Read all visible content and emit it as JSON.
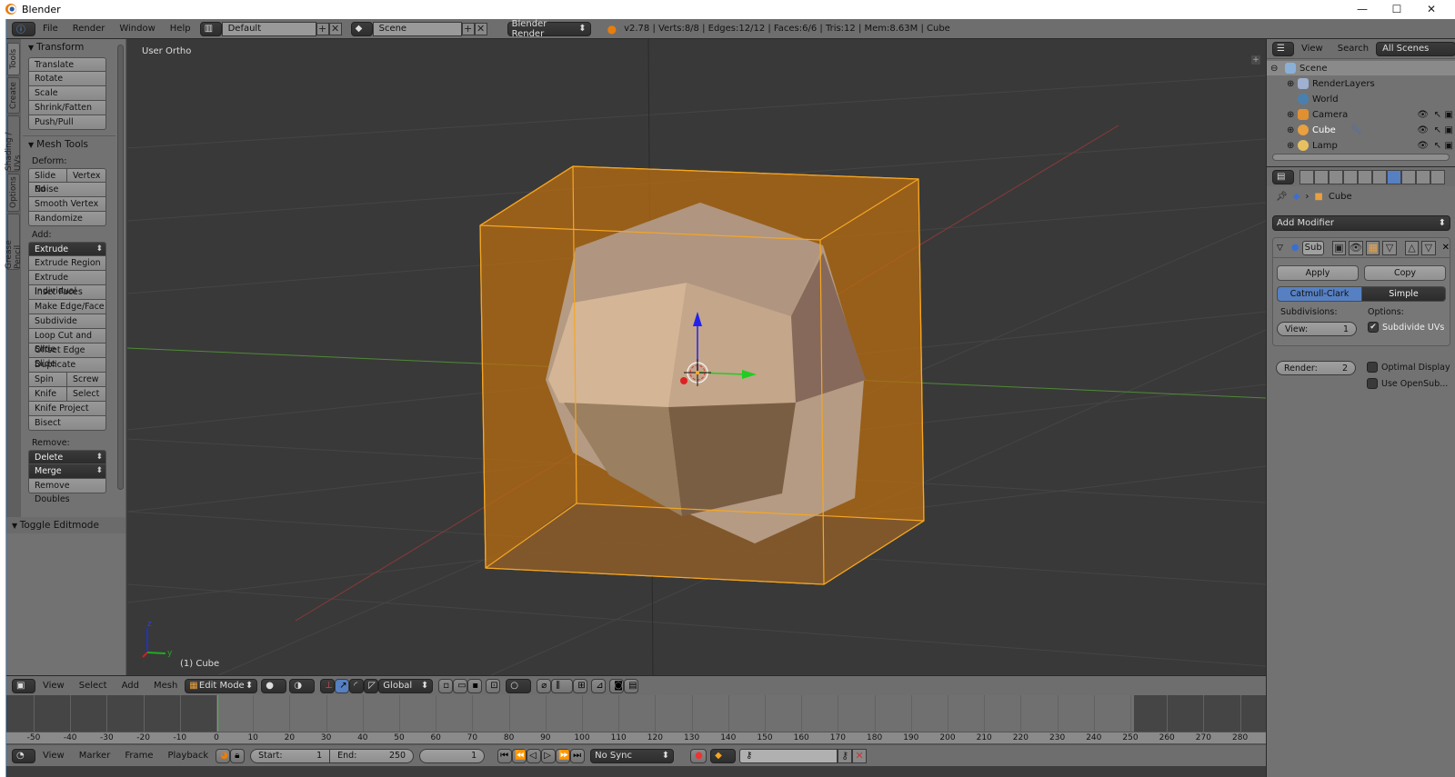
{
  "window": {
    "title": "Blender",
    "controls": {
      "minimize": "—",
      "maximize": "☐",
      "close": "✕"
    }
  },
  "infobar": {
    "menus": [
      "File",
      "Render",
      "Window",
      "Help"
    ],
    "layout": "Default",
    "scene": "Scene",
    "engine": "Blender Render",
    "stats": "v2.78 | Verts:8/8 | Edges:12/12 | Faces:6/6 | Tris:12 | Mem:8.63M | Cube"
  },
  "toolshelf": {
    "tabs": [
      "Tools",
      "Create",
      "Shading / UVs",
      "Options",
      "Grease Pencil"
    ],
    "active_tab": "Tools",
    "transform": {
      "title": "Transform",
      "buttons": [
        "Translate",
        "Rotate",
        "Scale",
        "Shrink/Fatten",
        "Push/Pull"
      ]
    },
    "mesh_tools": {
      "title": "Mesh Tools",
      "deform_label": "Deform:",
      "deform_row": [
        "Slide Ed",
        "Vertex"
      ],
      "deform_buttons": [
        "Noise",
        "Smooth Vertex",
        "Randomize"
      ],
      "add_label": "Add:",
      "extrude_dropdown": "Extrude",
      "add_buttons": [
        "Extrude Region",
        "Extrude Individual",
        "Inset Faces",
        "Make Edge/Face",
        "Subdivide",
        "Loop Cut and Slide",
        "Offset Edge Slide",
        "Duplicate"
      ],
      "add_row1": [
        "Spin",
        "Screw"
      ],
      "add_row2": [
        "Knife",
        "Select"
      ],
      "add_buttons2": [
        "Knife Project",
        "Bisect"
      ],
      "remove_label": "Remove:",
      "remove_dropdowns": [
        "Delete",
        "Merge"
      ],
      "remove_buttons": [
        "Remove Doubles"
      ]
    },
    "toggle_editmode": "Toggle Editmode"
  },
  "viewport": {
    "view_name": "User Ortho",
    "object_label": "(1) Cube",
    "axis_labels": {
      "z": "z",
      "y": "y"
    }
  },
  "view3d_header": {
    "menus": [
      "View",
      "Select",
      "Add",
      "Mesh"
    ],
    "mode": "Edit Mode",
    "orientation": "Global"
  },
  "timeline": {
    "ticks": [
      -50,
      -40,
      -30,
      -20,
      -10,
      0,
      10,
      20,
      30,
      40,
      50,
      60,
      70,
      80,
      90,
      100,
      110,
      120,
      130,
      140,
      150,
      160,
      170,
      180,
      190,
      200,
      210,
      220,
      230,
      240,
      250,
      260,
      270,
      280
    ],
    "current_frame": 1,
    "start_label": "Start:",
    "start": 1,
    "end_label": "End:",
    "end": 250,
    "menus": [
      "View",
      "Marker",
      "Frame",
      "Playback"
    ],
    "sync": "No Sync"
  },
  "outliner": {
    "menus": [
      "View",
      "Search"
    ],
    "filter": "All Scenes",
    "items": [
      {
        "name": "Scene",
        "icon": "scene-icon",
        "level": 0
      },
      {
        "name": "RenderLayers",
        "icon": "render-layers-icon",
        "level": 1
      },
      {
        "name": "World",
        "icon": "world-icon",
        "level": 1
      },
      {
        "name": "Camera",
        "icon": "camera-icon",
        "level": 1
      },
      {
        "name": "Cube",
        "icon": "mesh-icon",
        "level": 1
      },
      {
        "name": "Lamp",
        "icon": "lamp-icon",
        "level": 1
      }
    ]
  },
  "properties": {
    "breadcrumb_object": "Cube",
    "add_modifier": "Add Modifier",
    "modifier_name": "Sub",
    "apply": "Apply",
    "copy": "Copy",
    "subdiv_types": [
      "Catmull-Clark",
      "Simple"
    ],
    "active_type": "Catmull-Clark",
    "subdivisions_label": "Subdivisions:",
    "view_label": "View:",
    "view_value": 1,
    "render_label": "Render:",
    "render_value": 2,
    "options_label": "Options:",
    "options": [
      {
        "label": "Subdivide UVs",
        "checked": true
      },
      {
        "label": "Optimal Display",
        "checked": false
      },
      {
        "label": "Use OpenSub...",
        "checked": false
      }
    ]
  },
  "colors": {
    "selection_orange": "#f5a623",
    "active_blue": "#5680c2",
    "timeline_cursor": "#3ec53e"
  }
}
